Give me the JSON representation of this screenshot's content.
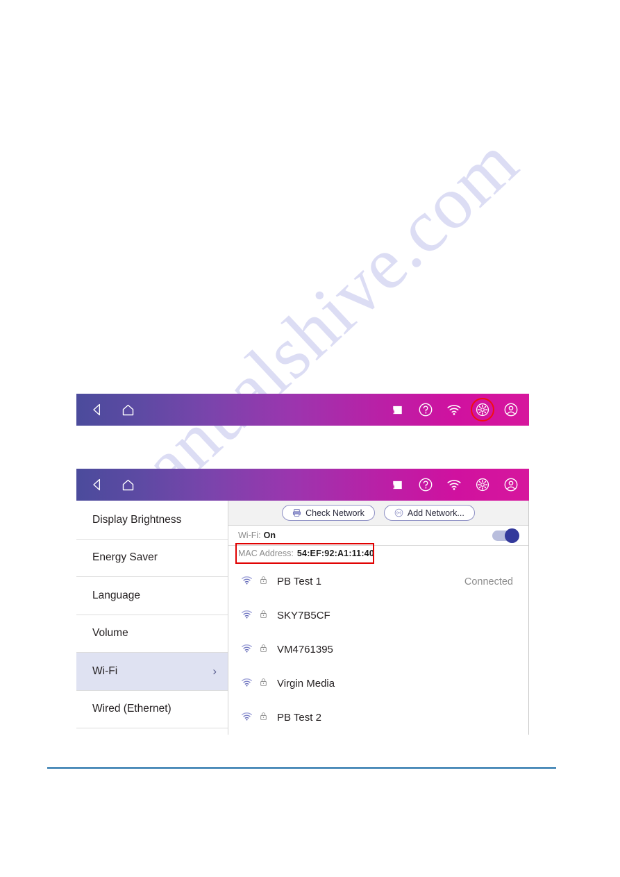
{
  "watermark": {
    "text": "manualshive.com"
  },
  "toolbar": {
    "back_label": "back-arrow",
    "home_label": "home",
    "cast_label": "cast",
    "help_label": "help",
    "wifi_label": "wifi",
    "settings_label": "settings",
    "account_label": "account",
    "highlight_color": "#f01010",
    "gradient_start": "#4b4b9c",
    "gradient_end": "#d6179d"
  },
  "sidebar": {
    "items": [
      {
        "label": "Display Brightness",
        "selected": false,
        "chevron": ""
      },
      {
        "label": "Energy Saver",
        "selected": false,
        "chevron": ""
      },
      {
        "label": "Language",
        "selected": false,
        "chevron": ""
      },
      {
        "label": "Volume",
        "selected": false,
        "chevron": ""
      },
      {
        "label": "Wi-Fi",
        "selected": true,
        "chevron": "›"
      },
      {
        "label": "Wired (Ethernet)",
        "selected": false,
        "chevron": ""
      }
    ]
  },
  "content": {
    "check_network_label": "Check Network",
    "add_network_label": "Add Network...",
    "wifi_state_label": "Wi-Fi:",
    "wifi_state_value": "On",
    "wifi_toggle_on": true,
    "mac_label": "MAC Address:",
    "mac_value": "54:EF:92:A1:11:40",
    "mac_highlight_color": "#e00000",
    "networks": [
      {
        "ssid": "PB Test 1",
        "secured": true,
        "status": "Connected"
      },
      {
        "ssid": "SKY7B5CF",
        "secured": true,
        "status": ""
      },
      {
        "ssid": "VM4761395",
        "secured": true,
        "status": ""
      },
      {
        "ssid": "Virgin Media",
        "secured": true,
        "status": ""
      },
      {
        "ssid": "PB Test 2",
        "secured": true,
        "status": ""
      }
    ]
  },
  "footer": {
    "rule_color": "#1f6fa8"
  }
}
